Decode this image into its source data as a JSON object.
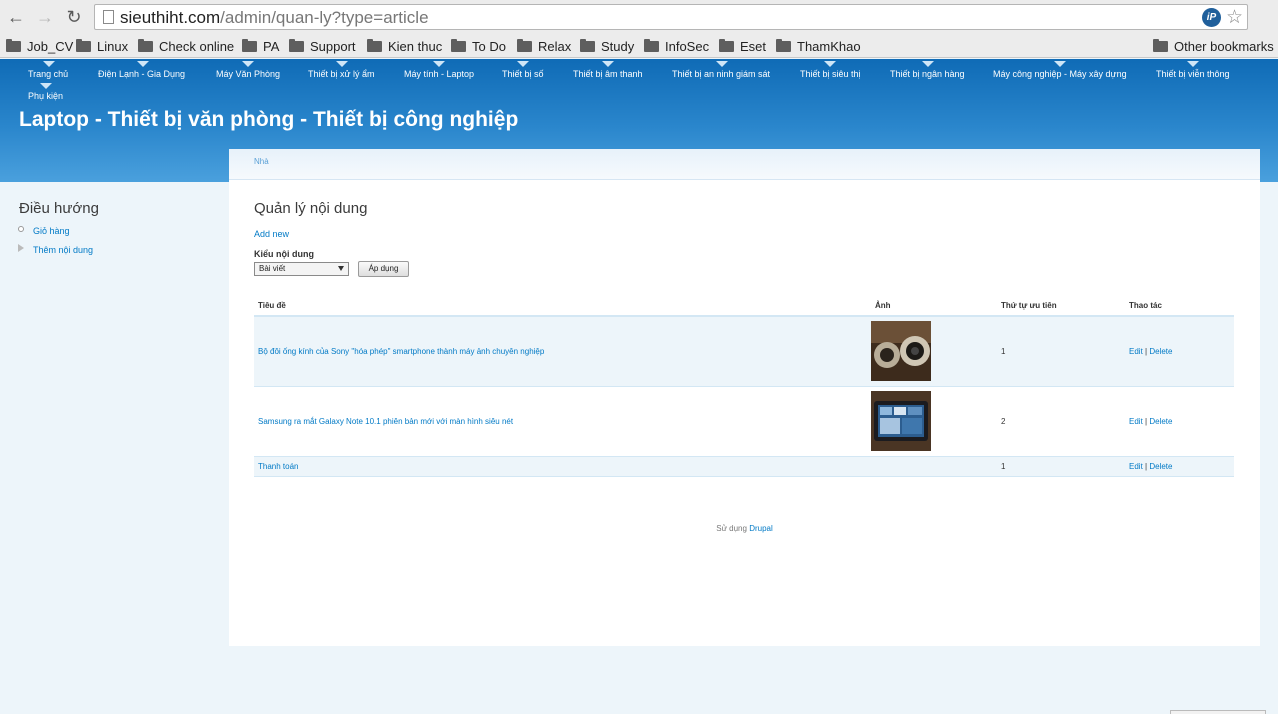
{
  "browser": {
    "url_host": "sieuthiht.com",
    "url_path": "/admin/quan-ly?type=article",
    "ext_label": "iP",
    "icons": {
      "back": "←",
      "forward": "→",
      "reload": "↻",
      "star": "☆"
    }
  },
  "bookmarks": {
    "items": [
      "Job_CV",
      "Linux",
      "Check online",
      "PA",
      "Support",
      "Kien thuc",
      "To Do",
      "Relax",
      "Study",
      "InfoSec",
      "Eset",
      "ThamKhao"
    ],
    "other": "Other bookmarks"
  },
  "menu": {
    "items": [
      "Trang chủ",
      "Điện Lạnh - Gia Dụng",
      "Máy Văn Phòng",
      "Thiết bị xử lý ẩm",
      "Máy tính - Laptop",
      "Thiết bị số",
      "Thiết bị âm thanh",
      "Thiết bị an ninh giám sát",
      "Thiết bị siêu thị",
      "Thiết bị ngân hàng",
      "Máy công nghiệp - Máy xây dựng",
      "Thiết bị viễn thông",
      "Phụ kiện"
    ]
  },
  "site": {
    "title": "Laptop - Thiết bị văn phòng - Thiết bị công nghiệp"
  },
  "sidebar": {
    "title": "Điều hướng",
    "items": [
      "Giỏ hàng",
      "Thêm nội dung"
    ]
  },
  "main": {
    "breadcrumb": "Nhà",
    "title": "Quản lý nội dung",
    "add_new": "Add new",
    "filter_label": "Kiểu nội dung",
    "filter_value": "Bài viết",
    "apply_label": "Áp dụng",
    "columns": [
      "Tiêu đề",
      "Ảnh",
      "Thứ tự ưu tiên",
      "Thao tác"
    ],
    "rows": [
      {
        "title": "Bộ đôi ống kính của Sony \"hóa phép\" smartphone thành máy ảnh chuyên nghiệp",
        "has_image": true,
        "priority": "1",
        "edit": "Edit",
        "sep": "|",
        "delete": "Delete"
      },
      {
        "title": "Samsung ra mắt Galaxy Note 10.1 phiên bản mới với màn hình siêu nét",
        "has_image": true,
        "priority": "2",
        "edit": "Edit",
        "sep": "|",
        "delete": "Delete"
      },
      {
        "title": "Thanh toán",
        "has_image": false,
        "priority": "1",
        "edit": "Edit",
        "sep": "|",
        "delete": "Delete"
      }
    ],
    "footer_prefix": "Sử dụng",
    "footer_link": "Drupal"
  },
  "colors": {
    "link": "#027ac6",
    "header_top": "#0f6bb6",
    "header_bottom": "#4aa0dd",
    "page_bg": "#edf5fa"
  }
}
